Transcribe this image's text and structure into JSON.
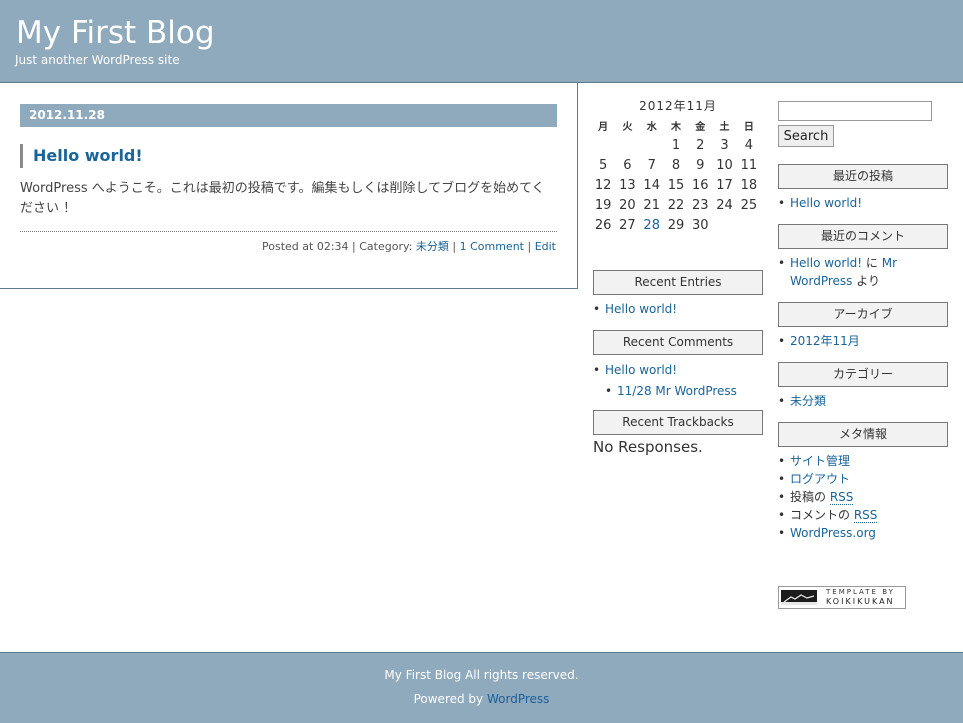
{
  "header": {
    "title": "My First Blog",
    "description": "Just another WordPress site"
  },
  "post": {
    "date": "2012.11.28",
    "title": "Hello world!",
    "body": "WordPress へようこそ。これは最初の投稿です。編集もしくは削除してブログを始めてください ！",
    "meta": {
      "posted_prefix": "Posted at 02:34 | Category: ",
      "category": "未分類",
      "sep1": " | ",
      "comments": "1 Comment",
      "sep2": " | ",
      "edit": "Edit"
    }
  },
  "calendar": {
    "caption": "2012年11月",
    "weekdays": [
      "月",
      "火",
      "水",
      "木",
      "金",
      "土",
      "日"
    ],
    "weeks": [
      [
        "",
        "",
        "",
        "1",
        "2",
        "3",
        "4"
      ],
      [
        "5",
        "6",
        "7",
        "8",
        "9",
        "10",
        "11"
      ],
      [
        "12",
        "13",
        "14",
        "15",
        "16",
        "17",
        "18"
      ],
      [
        "19",
        "20",
        "21",
        "22",
        "23",
        "24",
        "25"
      ],
      [
        "26",
        "27",
        "28",
        "29",
        "30",
        "",
        ""
      ]
    ],
    "linked_day": "28"
  },
  "recent_entries": {
    "title": "Recent Entries",
    "items": [
      "Hello world!"
    ]
  },
  "recent_comments": {
    "title": "Recent Comments",
    "post": "Hello world!",
    "comment": "11/28 Mr WordPress"
  },
  "recent_trackbacks": {
    "title": "Recent Trackbacks",
    "empty_text": "No Responses."
  },
  "search": {
    "button_label": "Search",
    "value": ""
  },
  "latest_posts": {
    "title": "最近の投稿",
    "items": [
      "Hello world!"
    ]
  },
  "latest_comments": {
    "title": "最近のコメント",
    "post_link": "Hello world!",
    "on_text": " に ",
    "author_link": "Mr WordPress",
    "suffix": " より"
  },
  "archives": {
    "title": "アーカイブ",
    "items": [
      "2012年11月"
    ]
  },
  "categories": {
    "title": "カテゴリー",
    "items": [
      "未分類"
    ]
  },
  "meta_widget": {
    "title": "メタ情報",
    "site_admin": "サイト管理",
    "logout": "ログアウト",
    "posts_prefix": "投稿の ",
    "posts_rss": "RSS",
    "comments_prefix": "コメントの ",
    "comments_rss": "RSS",
    "wordpress_org": "WordPress.org"
  },
  "template_badge": {
    "line1": "TEMPLATE BY",
    "line2": "KOIKIKUKAN"
  },
  "footer": {
    "copyright": "My First Blog All rights reserved.",
    "powered_prefix": "Powered by ",
    "powered_link": "WordPress"
  },
  "colors": {
    "header_bg": "#8faabc",
    "link": "#1a6497"
  }
}
